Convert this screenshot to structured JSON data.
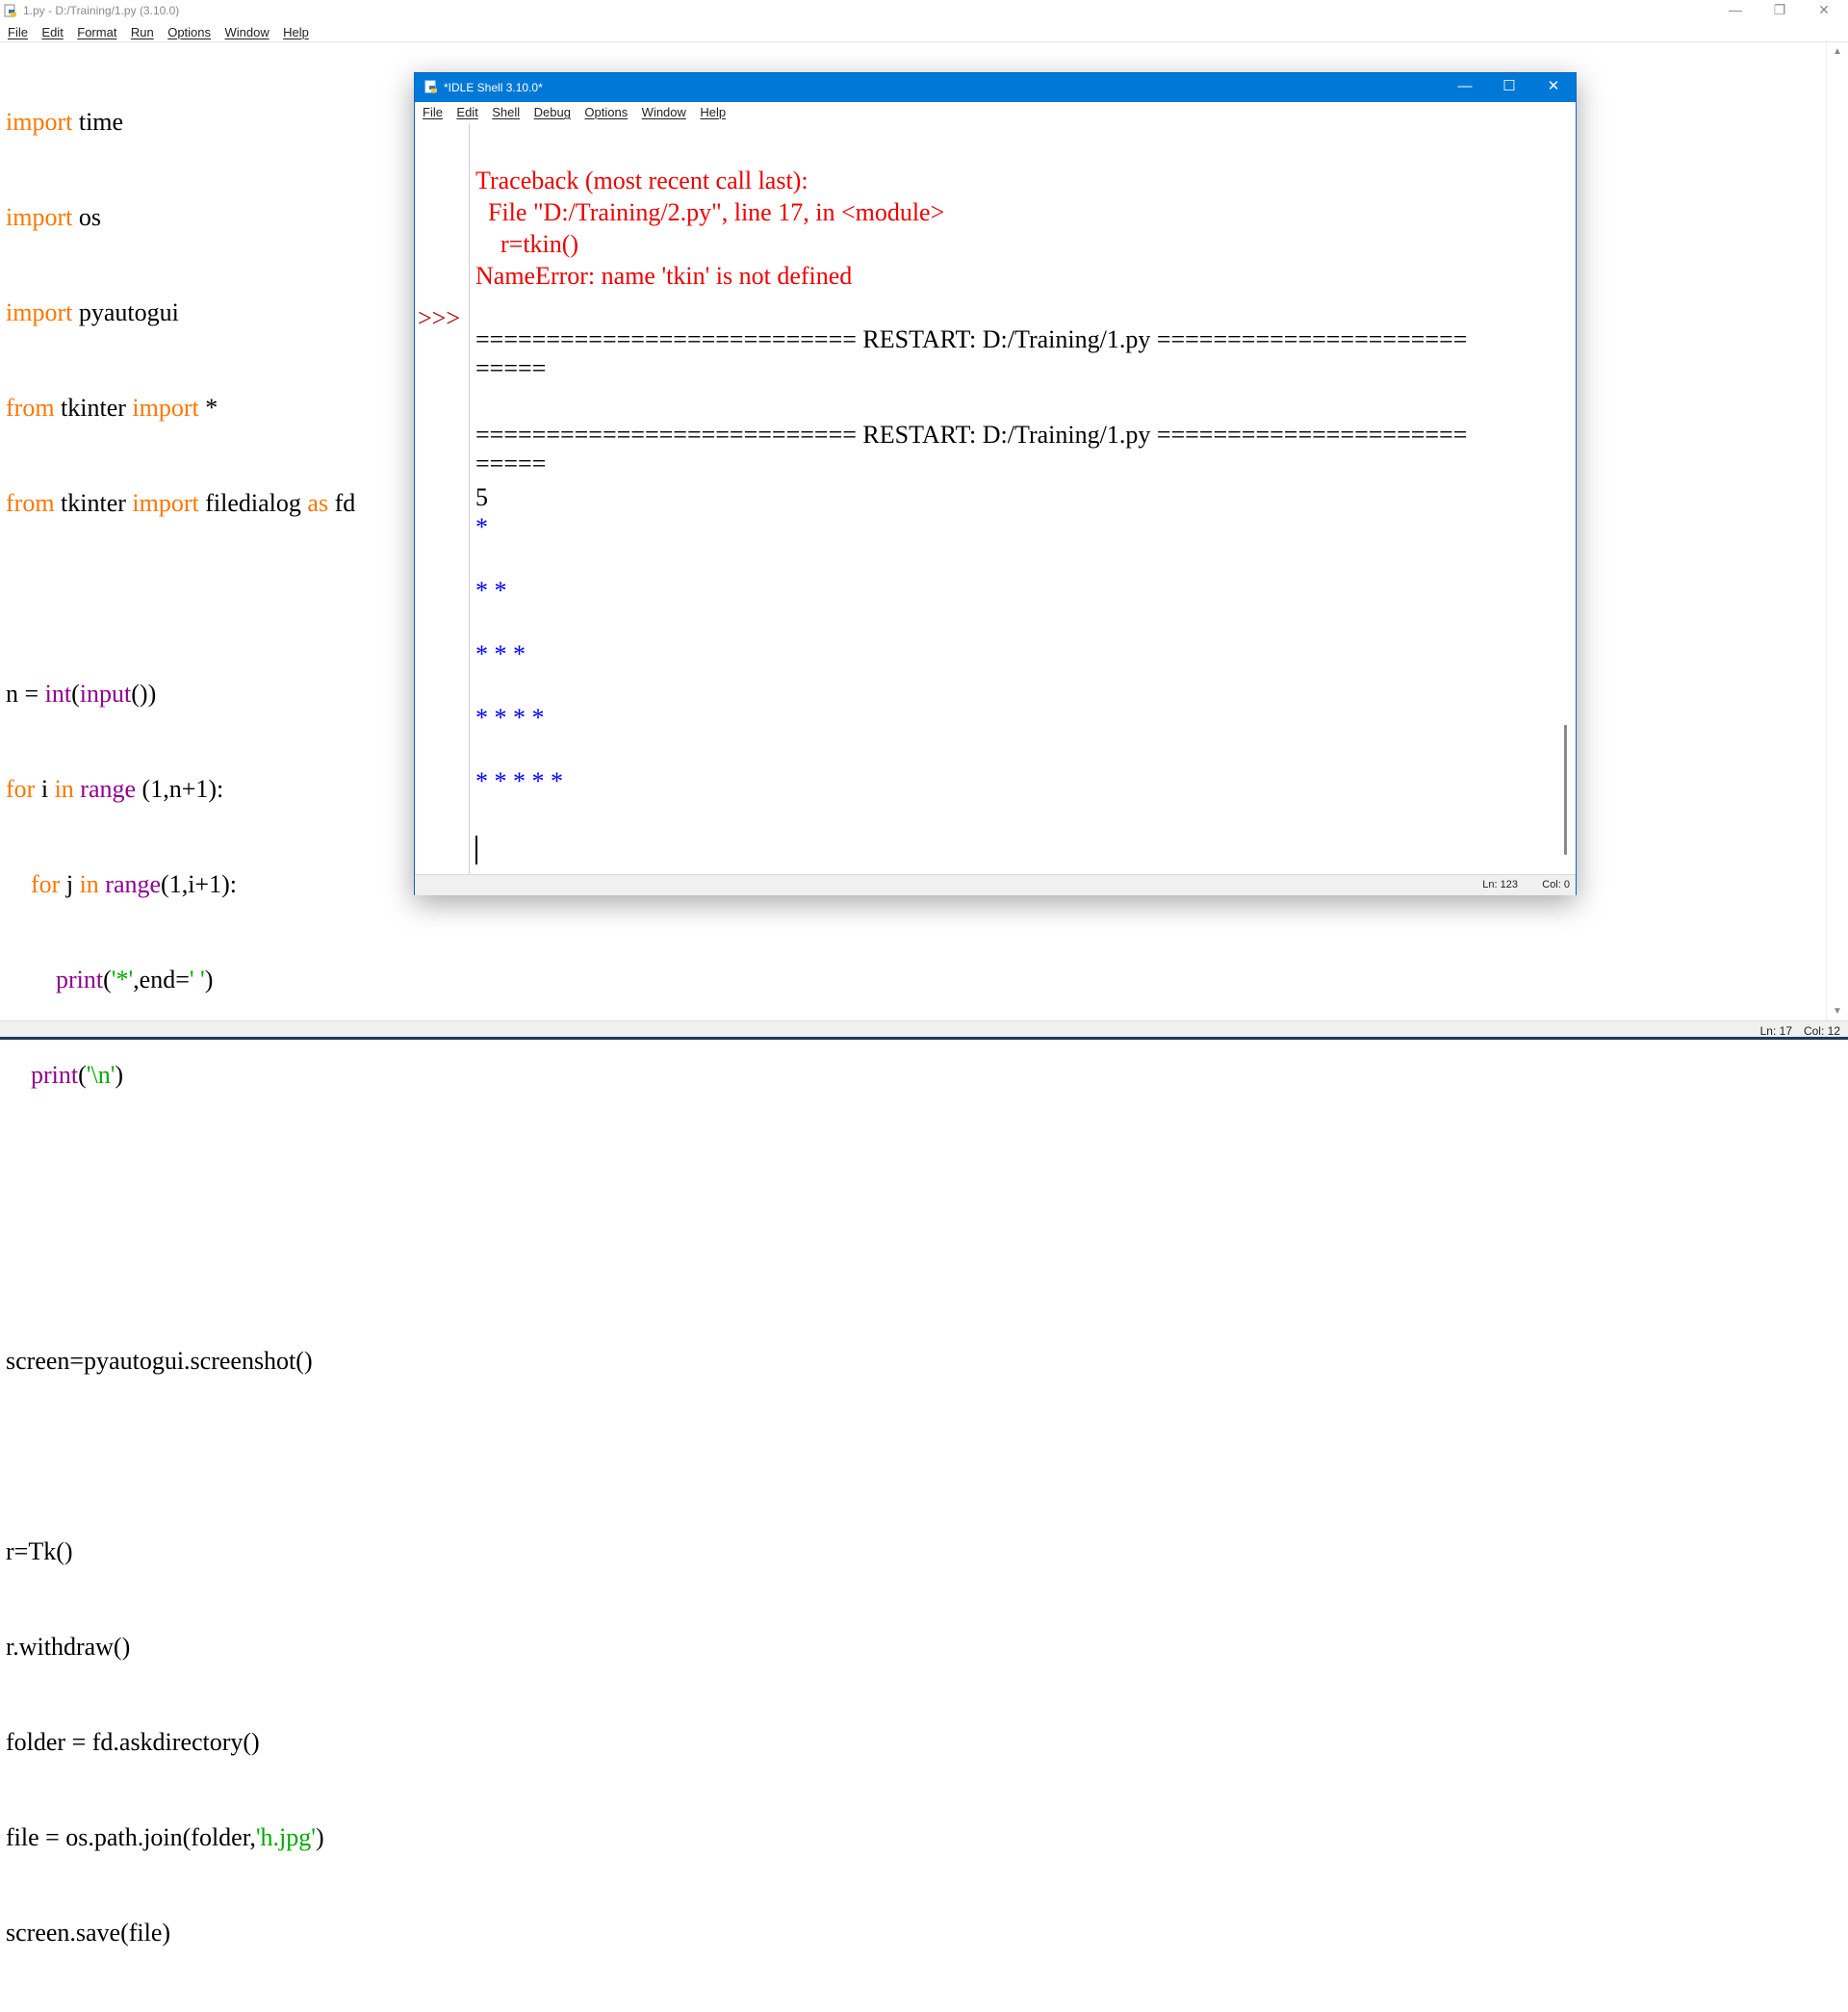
{
  "editor": {
    "title": "1.py - D:/Training/1.py (3.10.0)",
    "window_controls": {
      "minimize": "—",
      "maximize": "❐",
      "close": "✕"
    },
    "menu": [
      "File",
      "Edit",
      "Format",
      "Run",
      "Options",
      "Window",
      "Help"
    ],
    "status": {
      "ln": "Ln: 17",
      "col": "Col: 12"
    }
  },
  "shell": {
    "title": "*IDLE Shell 3.10.0*",
    "window_controls": {
      "minimize": "—",
      "maximize": "☐",
      "close": "✕"
    },
    "menu": [
      "File",
      "Edit",
      "Shell",
      "Debug",
      "Options",
      "Window",
      "Help"
    ],
    "prompt": ">>>",
    "lines": {
      "partial_top": "* * * * *",
      "tb_header": "Traceback (most recent call last):",
      "tb_file": "  File \"D:/Training/2.py\", line 17, in <module>",
      "tb_code": "    r=tkin()",
      "tb_error": "NameError: name 'tkin' is not defined",
      "restart1": "=========================== RESTART: D:/Training/1.py ======================",
      "restart1_wrap": "=====",
      "restart2": "=========================== RESTART: D:/Training/1.py ======================",
      "restart2_wrap": "=====",
      "input_value": "5",
      "stars1": "*",
      "stars2": "* *",
      "stars3": "* * *",
      "stars4": "* * * *",
      "stars5": "* * * * *"
    },
    "status": {
      "ln": "Ln: 123",
      "col": "Col: 0"
    }
  }
}
